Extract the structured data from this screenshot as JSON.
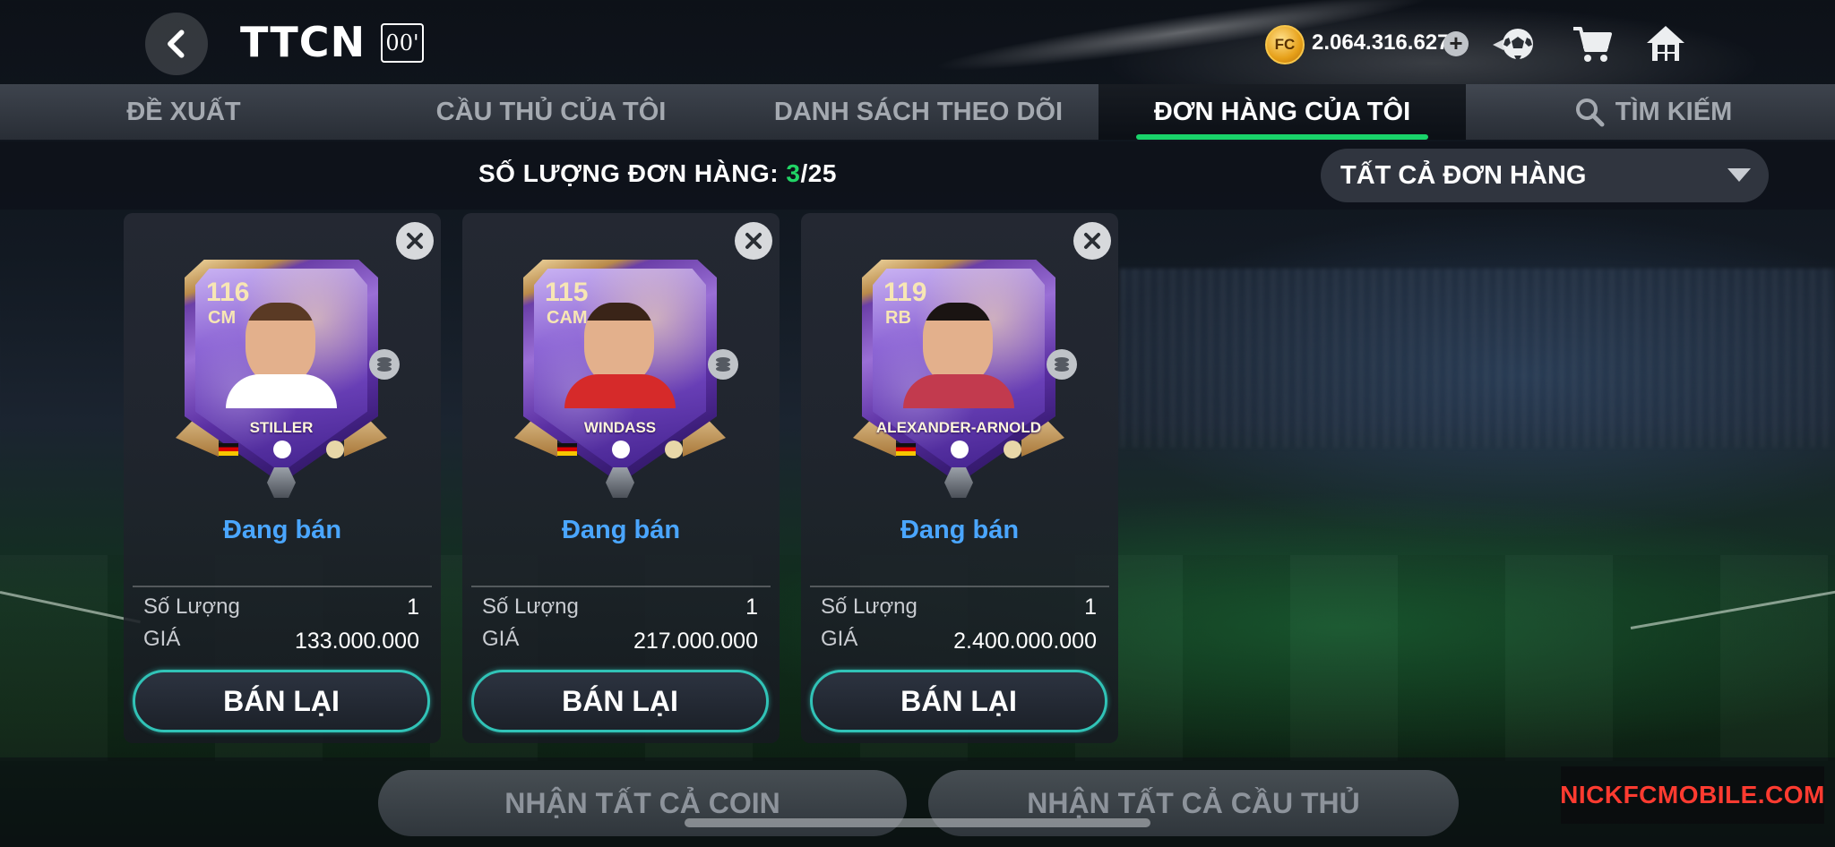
{
  "header": {
    "title": "TTCN",
    "time_badge": "00'",
    "coins": "2.064.316.627",
    "coin_icon_label": "FC"
  },
  "tabs": [
    {
      "label": "ĐỀ XUẤT",
      "active": false
    },
    {
      "label": "CẦU THỦ CỦA TÔI",
      "active": false
    },
    {
      "label": "DANH SÁCH THEO DÕI",
      "active": false
    },
    {
      "label": "ĐƠN HÀNG CỦA TÔI",
      "active": true
    },
    {
      "label": "TÌM KIẾM",
      "active": false
    }
  ],
  "orders": {
    "count_label": "SỐ LƯỢNG ĐƠN HÀNG:",
    "count_current": "3",
    "count_max": "/25",
    "filter_value": "TẤT CẢ ĐƠN HÀNG"
  },
  "cards": [
    {
      "rating": "116",
      "position": "CM",
      "name": "STILLER",
      "status": "Đang bán",
      "qty_label": "Số Lượng",
      "qty": "1",
      "price_label": "GIÁ",
      "price": "133.000.000",
      "button": "BÁN LẠI",
      "hair": "#5a3a24",
      "kit": "#ffffff"
    },
    {
      "rating": "115",
      "position": "CAM",
      "name": "WINDASS",
      "status": "Đang bán",
      "qty_label": "Số Lượng",
      "qty": "1",
      "price_label": "GIÁ",
      "price": "217.000.000",
      "button": "BÁN LẠI",
      "hair": "#3a2418",
      "kit": "#d62a2a"
    },
    {
      "rating": "119",
      "position": "RB",
      "name": "ALEXANDER-ARNOLD",
      "status": "Đang bán",
      "qty_label": "Số Lượng",
      "qty": "1",
      "price_label": "GIÁ",
      "price": "2.400.000.000",
      "button": "BÁN LẠI",
      "hair": "#1a1412",
      "kit": "#c23a4e"
    }
  ],
  "footer": {
    "claim_coins": "NHẬN TẤT CẢ COIN",
    "claim_players": "NHẬN TẤT CẢ CẦU THỦ",
    "watermark": "NICKFCMOBILE.COM"
  },
  "colors": {
    "accent_green": "#19d36a",
    "status_blue": "#4aa6ff",
    "button_border": "#31c3b7"
  }
}
